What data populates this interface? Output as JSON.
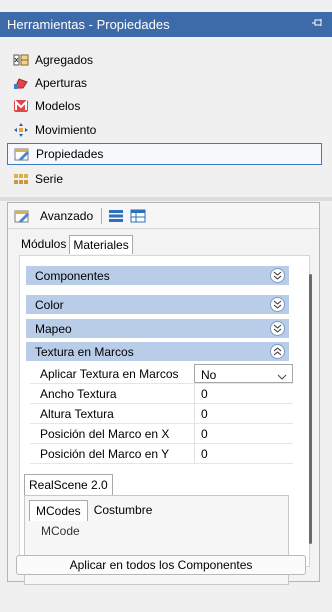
{
  "window": {
    "title": "Herramientas - Propiedades",
    "pin_icon": "pin-icon"
  },
  "nav": {
    "items": [
      {
        "label": "Agregados",
        "icon": "aggregates-icon",
        "selected": false
      },
      {
        "label": "Aperturas",
        "icon": "openings-icon",
        "selected": false
      },
      {
        "label": "Modelos",
        "icon": "models-icon",
        "selected": false
      },
      {
        "label": "Movimiento",
        "icon": "move-icon",
        "selected": false
      },
      {
        "label": "Propiedades",
        "icon": "properties-icon",
        "selected": true
      },
      {
        "label": "Serie",
        "icon": "series-icon",
        "selected": false
      }
    ]
  },
  "toolbar": {
    "advanced_label": "Avanzado"
  },
  "tabs": {
    "modules_label": "Módulos",
    "materials_label": "Materiales",
    "active": "Materiales"
  },
  "sections": {
    "componentes": "Componentes",
    "color": "Color",
    "mapeo": "Mapeo",
    "textura": "Textura en Marcos"
  },
  "properties": [
    {
      "name": "Aplicar Textura en Marcos",
      "value": "No",
      "type": "dropdown"
    },
    {
      "name": "Ancho Textura",
      "value": "0",
      "type": "text"
    },
    {
      "name": "Altura Textura",
      "value": "0",
      "type": "text"
    },
    {
      "name": "Posición del Marco en X",
      "value": "0",
      "type": "text"
    },
    {
      "name": "Posición del Marco en Y",
      "value": "0",
      "type": "text"
    }
  ],
  "realscene": {
    "tab_label": "RealScene 2.0",
    "mcodes_tab": "MCodes",
    "costumbre_tab": "Costumbre",
    "mcode_label": "MCode"
  },
  "apply_button": "Aplicar en todos los Componentes",
  "colors": {
    "titlebar": "#3d6aa8",
    "section_header": "#b9cde8",
    "selection_border": "#3d7bc4"
  }
}
